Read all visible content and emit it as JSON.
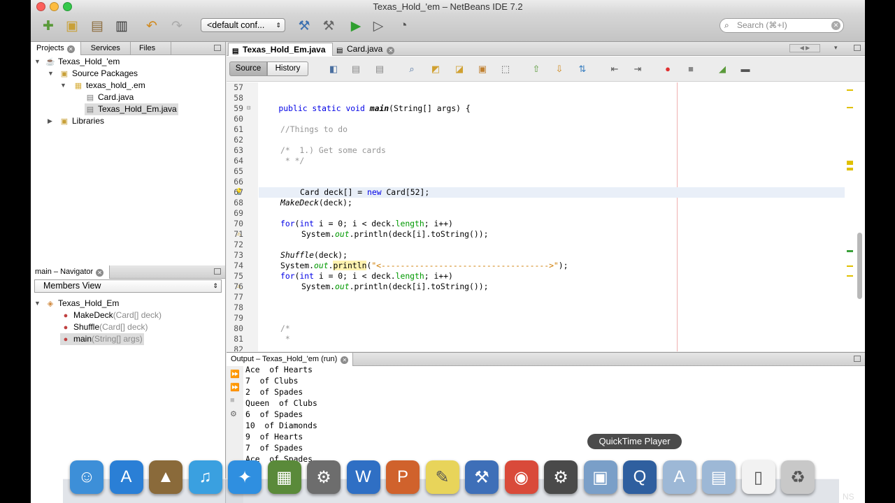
{
  "window": {
    "title": "Texas_Hold_'em – NetBeans IDE 7.2"
  },
  "toolbar": {
    "config": "<default conf...",
    "search_placeholder": "Search (⌘+I)"
  },
  "projects_panel": {
    "tabs": [
      {
        "label": "Projects"
      },
      {
        "label": "Services"
      },
      {
        "label": "Files"
      }
    ],
    "tree": {
      "project": "Texas_Hold_'em",
      "source_packages": "Source Packages",
      "package": "texas_hold_.em",
      "file1": "Card.java",
      "file2": "Texas_Hold_Em.java",
      "libraries": "Libraries"
    }
  },
  "navigator": {
    "title": "main – Navigator",
    "view": "Members View",
    "class": "Texas_Hold_Em",
    "members": [
      {
        "name": "MakeDeck",
        "params": "(Card[] deck)"
      },
      {
        "name": "Shuffle",
        "params": "(Card[] deck)"
      },
      {
        "name": "main",
        "params": "(String[] args)"
      }
    ]
  },
  "editor": {
    "tabs": [
      {
        "label": "Texas_Hold_Em.java"
      },
      {
        "label": "Card.java"
      }
    ],
    "source_label": "Source",
    "history_label": "History",
    "lines": [
      {
        "n": "57",
        "c": ""
      },
      {
        "n": "58",
        "c": ""
      },
      {
        "n": "59",
        "c": "    public static void main(String[] args) {"
      },
      {
        "n": "60",
        "c": ""
      },
      {
        "n": "61",
        "c": "        //Things to do"
      },
      {
        "n": "62",
        "c": ""
      },
      {
        "n": "63",
        "c": "        /*  1.) Get some cards"
      },
      {
        "n": "64",
        "c": "         * */"
      },
      {
        "n": "65",
        "c": ""
      },
      {
        "n": "66",
        "c": ""
      },
      {
        "n": "67",
        "c": "        Card deck[] = new Card[52];"
      },
      {
        "n": "68",
        "c": "        MakeDeck(deck);"
      },
      {
        "n": "69",
        "c": ""
      },
      {
        "n": "70",
        "c": "        for(int i = 0; i < deck.length; i++)"
      },
      {
        "n": "71",
        "c": "            System.out.println(deck[i].toString());"
      },
      {
        "n": "72",
        "c": ""
      },
      {
        "n": "73",
        "c": "        Shuffle(deck);"
      },
      {
        "n": "74",
        "c": "        System.out.println(\"<----------------------------------->\");"
      },
      {
        "n": "75",
        "c": "        for(int i = 0; i < deck.length; i++)"
      },
      {
        "n": "76",
        "c": "            System.out.println(deck[i].toString());"
      },
      {
        "n": "77",
        "c": ""
      },
      {
        "n": "78",
        "c": ""
      },
      {
        "n": "79",
        "c": ""
      },
      {
        "n": "80",
        "c": "        /*"
      },
      {
        "n": "81",
        "c": "         *"
      },
      {
        "n": "82",
        "c": ""
      }
    ]
  },
  "output": {
    "title": "Output – Texas_Hold_'em (run)",
    "lines": [
      "Ace  of Hearts",
      "7  of Clubs",
      "2  of Spades",
      "Queen  of Clubs",
      "6  of Spades",
      "10  of Diamonds",
      "9  of Hearts",
      "7  of Spades",
      "Ace  of Spades"
    ]
  },
  "dock": {
    "tooltip": "QuickTime Player",
    "apps": [
      {
        "icon": "finder-icon",
        "color": "#3d8fd8"
      },
      {
        "icon": "app-store-icon",
        "color": "#2a7fd6"
      },
      {
        "icon": "iphoto-icon",
        "color": "#8a6a3a"
      },
      {
        "icon": "itunes-icon",
        "color": "#3aa0e0"
      },
      {
        "icon": "safari-icon",
        "color": "#2f8fe0"
      },
      {
        "icon": "minecraft-icon",
        "color": "#5a8a3a"
      },
      {
        "icon": "system-preferences-icon",
        "color": "#6d6d6d"
      },
      {
        "icon": "word-icon",
        "color": "#2f6fc4"
      },
      {
        "icon": "powerpoint-icon",
        "color": "#d0622c"
      },
      {
        "icon": "stickies-icon",
        "color": "#e8d45a"
      },
      {
        "icon": "xcode-icon",
        "color": "#3e6fb8"
      },
      {
        "icon": "chrome-icon",
        "color": "#d94a3a"
      },
      {
        "icon": "steam-icon",
        "color": "#4a4a4a"
      },
      {
        "icon": "virtualbox-icon",
        "color": "#7a9fc8"
      },
      {
        "icon": "quicktime-icon",
        "color": "#2f5f9f"
      },
      {
        "icon": "applications-folder-icon",
        "color": "#9db8d6"
      },
      {
        "icon": "documents-folder-icon",
        "color": "#9db8d6"
      },
      {
        "icon": "file-icon",
        "color": "#f2f2f2"
      },
      {
        "icon": "trash-icon",
        "color": "#c8c8c8"
      }
    ]
  },
  "colors": {
    "keyword": "#0000e6",
    "comment": "#969696",
    "string": "#ce7b00",
    "field": "#009900"
  }
}
